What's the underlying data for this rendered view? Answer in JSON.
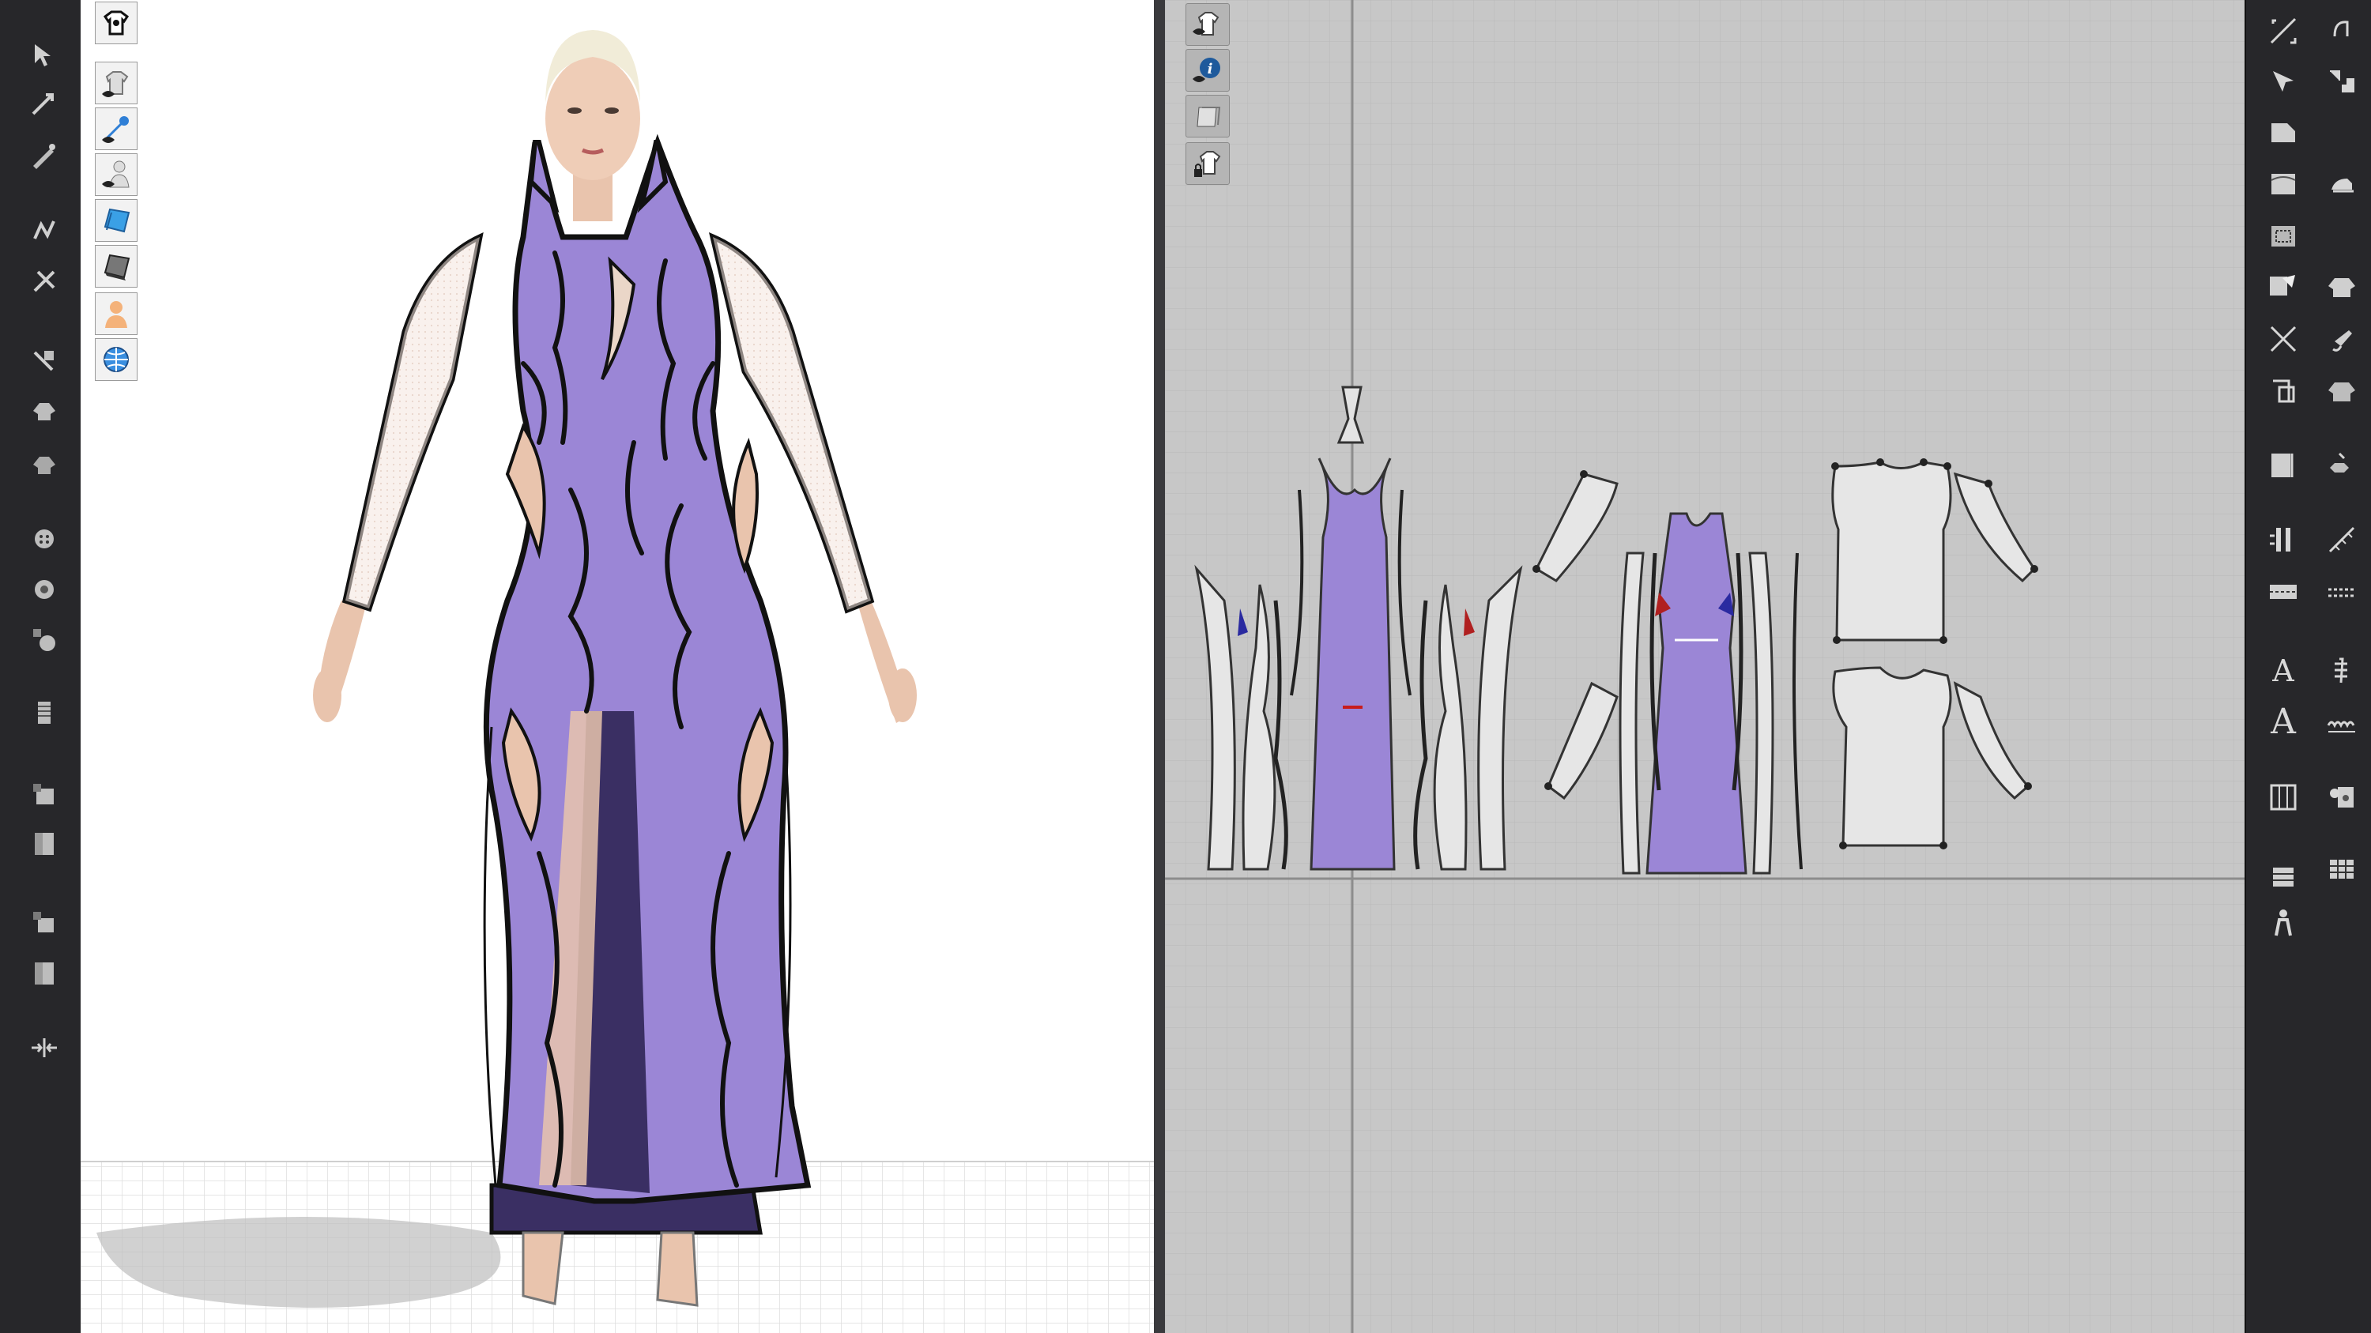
{
  "app": {
    "accent": "#2f7fd6",
    "garment_color": "#9b86d6",
    "garment_dark": "#3a2f63",
    "viewport_bg": "#ffffff",
    "pattern_bg": "#c7c7c7",
    "toolbar_bg": "#27272a"
  },
  "left_strip": {
    "tools": [
      "select-icon",
      "transform-icon",
      "edit-pattern-icon",
      "fold-icon",
      "pin-icon",
      "tack-icon",
      "avatar-icon",
      "zipper-icon",
      "button-icon",
      "snap-icon",
      "graphic-icon",
      "texture-icon",
      "measure-icon",
      "fit-icon",
      "record-icon",
      "scale-icon"
    ]
  },
  "view3d": {
    "toolbar_icons": [
      "garment-display-icon",
      "show-garment-icon",
      "show-pins-icon",
      "show-avatar-icon",
      "texture-surface-icon",
      "thick-surface-icon",
      "skin-icon",
      "environment-icon"
    ]
  },
  "view2d": {
    "toolbar_icons": [
      "show-pattern-icon",
      "info-icon",
      "pattern-thickness-icon",
      "lock-pattern-icon"
    ]
  },
  "right_toolbar": {
    "letter_tool_1": "A",
    "letter_tool_2": "A",
    "tools": [
      "transform-pattern-icon",
      "edit-point-icon",
      "polygon-icon",
      "rectangle-icon",
      "internal-polygon-icon",
      "dart-icon",
      "trace-icon",
      "segment-sewing-icon",
      "add-seam-icon",
      "free-sewing-icon",
      "fold-arrangement-icon",
      "steam-icon",
      "tack-icon",
      "cut-icon",
      "ruler-icon",
      "measure-icon",
      "zipper-icon",
      "elastic-icon",
      "topstitch-icon",
      "puckering-icon",
      "grid-icon",
      "trim-icon",
      "avatar-pose-icon",
      "gather-icon"
    ]
  }
}
